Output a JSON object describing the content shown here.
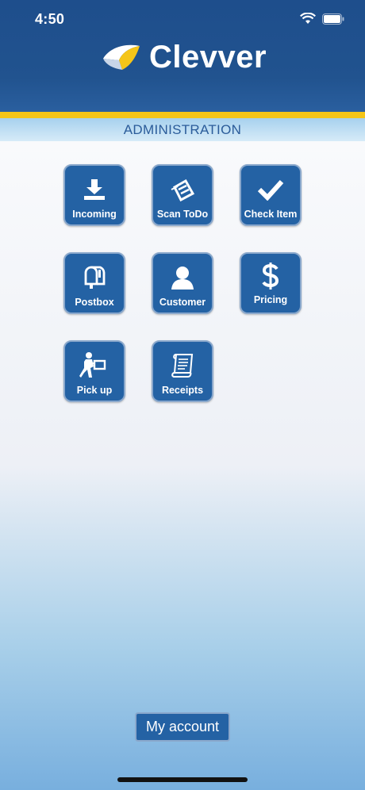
{
  "status_bar": {
    "time": "4:50"
  },
  "header": {
    "app_name": "Clevver"
  },
  "section": {
    "title": "ADMINISTRATION"
  },
  "tiles": [
    {
      "label": "Incoming",
      "icon": "download-icon"
    },
    {
      "label": "Scan ToDo",
      "icon": "scanner-icon"
    },
    {
      "label": "Check Item",
      "icon": "checkmark-icon"
    },
    {
      "label": "Postbox",
      "icon": "mailbox-icon"
    },
    {
      "label": "Customer",
      "icon": "person-icon"
    },
    {
      "label": "Pricing",
      "icon": "dollar-icon"
    },
    {
      "label": "Pick up",
      "icon": "delivery-person-icon"
    },
    {
      "label": "Receipts",
      "icon": "receipt-icon"
    }
  ],
  "footer": {
    "account_button": "My account"
  },
  "colors": {
    "brand_blue": "#2462a4",
    "header_blue": "#1e4e8c",
    "accent_yellow": "#f5c518"
  }
}
